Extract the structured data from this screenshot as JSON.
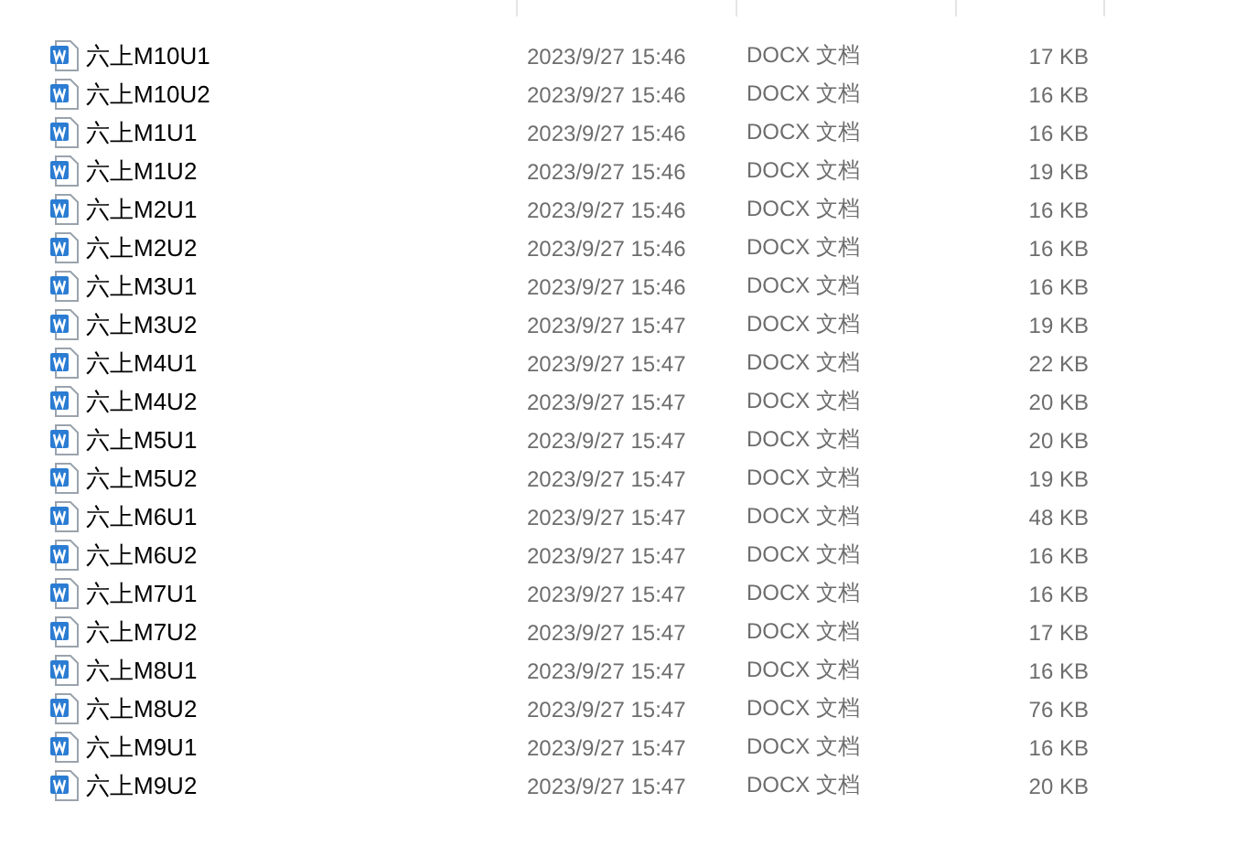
{
  "files": [
    {
      "name": "六上M10U1",
      "modified": "2023/9/27 15:46",
      "type": "DOCX 文档",
      "size": "17 KB"
    },
    {
      "name": "六上M10U2",
      "modified": "2023/9/27 15:46",
      "type": "DOCX 文档",
      "size": "16 KB"
    },
    {
      "name": "六上M1U1",
      "modified": "2023/9/27 15:46",
      "type": "DOCX 文档",
      "size": "16 KB"
    },
    {
      "name": "六上M1U2",
      "modified": "2023/9/27 15:46",
      "type": "DOCX 文档",
      "size": "19 KB"
    },
    {
      "name": "六上M2U1",
      "modified": "2023/9/27 15:46",
      "type": "DOCX 文档",
      "size": "16 KB"
    },
    {
      "name": "六上M2U2",
      "modified": "2023/9/27 15:46",
      "type": "DOCX 文档",
      "size": "16 KB"
    },
    {
      "name": "六上M3U1",
      "modified": "2023/9/27 15:46",
      "type": "DOCX 文档",
      "size": "16 KB"
    },
    {
      "name": "六上M3U2",
      "modified": "2023/9/27 15:47",
      "type": "DOCX 文档",
      "size": "19 KB"
    },
    {
      "name": "六上M4U1",
      "modified": "2023/9/27 15:47",
      "type": "DOCX 文档",
      "size": "22 KB"
    },
    {
      "name": "六上M4U2",
      "modified": "2023/9/27 15:47",
      "type": "DOCX 文档",
      "size": "20 KB"
    },
    {
      "name": "六上M5U1",
      "modified": "2023/9/27 15:47",
      "type": "DOCX 文档",
      "size": "20 KB"
    },
    {
      "name": "六上M5U2",
      "modified": "2023/9/27 15:47",
      "type": "DOCX 文档",
      "size": "19 KB"
    },
    {
      "name": "六上M6U1",
      "modified": "2023/9/27 15:47",
      "type": "DOCX 文档",
      "size": "48 KB"
    },
    {
      "name": "六上M6U2",
      "modified": "2023/9/27 15:47",
      "type": "DOCX 文档",
      "size": "16 KB"
    },
    {
      "name": "六上M7U1",
      "modified": "2023/9/27 15:47",
      "type": "DOCX 文档",
      "size": "16 KB"
    },
    {
      "name": "六上M7U2",
      "modified": "2023/9/27 15:47",
      "type": "DOCX 文档",
      "size": "17 KB"
    },
    {
      "name": "六上M8U1",
      "modified": "2023/9/27 15:47",
      "type": "DOCX 文档",
      "size": "16 KB"
    },
    {
      "name": "六上M8U2",
      "modified": "2023/9/27 15:47",
      "type": "DOCX 文档",
      "size": "76 KB"
    },
    {
      "name": "六上M9U1",
      "modified": "2023/9/27 15:47",
      "type": "DOCX 文档",
      "size": "16 KB"
    },
    {
      "name": "六上M9U2",
      "modified": "2023/9/27 15:47",
      "type": "DOCX 文档",
      "size": "20 KB"
    }
  ]
}
